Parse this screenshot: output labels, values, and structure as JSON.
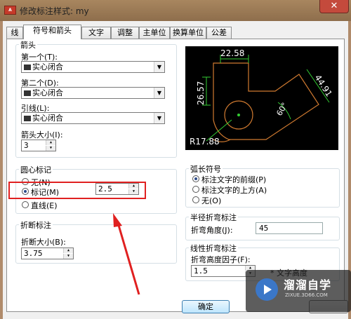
{
  "window": {
    "title": "修改标注样式: my",
    "app_icon_text": "A",
    "close_glyph": "✕"
  },
  "tabs": [
    {
      "label": "线",
      "active": false
    },
    {
      "label": "符号和箭头",
      "active": true
    },
    {
      "label": "文字",
      "active": false
    },
    {
      "label": "调整",
      "active": false
    },
    {
      "label": "主单位",
      "active": false
    },
    {
      "label": "换算单位",
      "active": false
    },
    {
      "label": "公差",
      "active": false
    }
  ],
  "arrowheads": {
    "group_label": "箭头",
    "first_label": "第一个(T):",
    "first_value": "实心闭合",
    "second_label": "第二个(D):",
    "second_value": "实心闭合",
    "leader_label": "引线(L):",
    "leader_value": "实心闭合",
    "size_label": "箭头大小(I):",
    "size_value": "3"
  },
  "center_marks": {
    "group_label": "圆心标记",
    "options": [
      {
        "label": "无(N)",
        "selected": false
      },
      {
        "label": "标记(M)",
        "selected": true
      },
      {
        "label": "直线(E)",
        "selected": false
      }
    ],
    "size_value": "2.5"
  },
  "dim_break": {
    "group_label": "折断标注",
    "size_label": "折断大小(B):",
    "size_value": "3.75"
  },
  "arc_length": {
    "group_label": "弧长符号",
    "options": [
      {
        "label": "标注文字的前缀(P)",
        "selected": true
      },
      {
        "label": "标注文字的上方(A)",
        "selected": false
      },
      {
        "label": "无(O)",
        "selected": false
      }
    ]
  },
  "radius_jog": {
    "group_label": "半径折弯标注",
    "angle_label": "折弯角度(J):",
    "angle_value": "45"
  },
  "linear_jog": {
    "group_label": "线性折弯标注",
    "factor_label": "折弯高度因子(F):",
    "factor_value": "1.5",
    "trailing_text": "* 文字高度"
  },
  "preview": {
    "dim_top": "22.58",
    "dim_left": "26.57",
    "dim_right": "44.91",
    "dim_angle": "60°",
    "dim_radius": "R17.88"
  },
  "buttons": {
    "ok": "确定"
  },
  "watermark": {
    "title": "溜溜自学",
    "subtitle": "ZIXUE.3D66.COM"
  },
  "colors": {
    "highlight": "#e02020",
    "preview_bg": "#000000",
    "preview_green": "#33cc33",
    "preview_orange": "#d07a30"
  }
}
